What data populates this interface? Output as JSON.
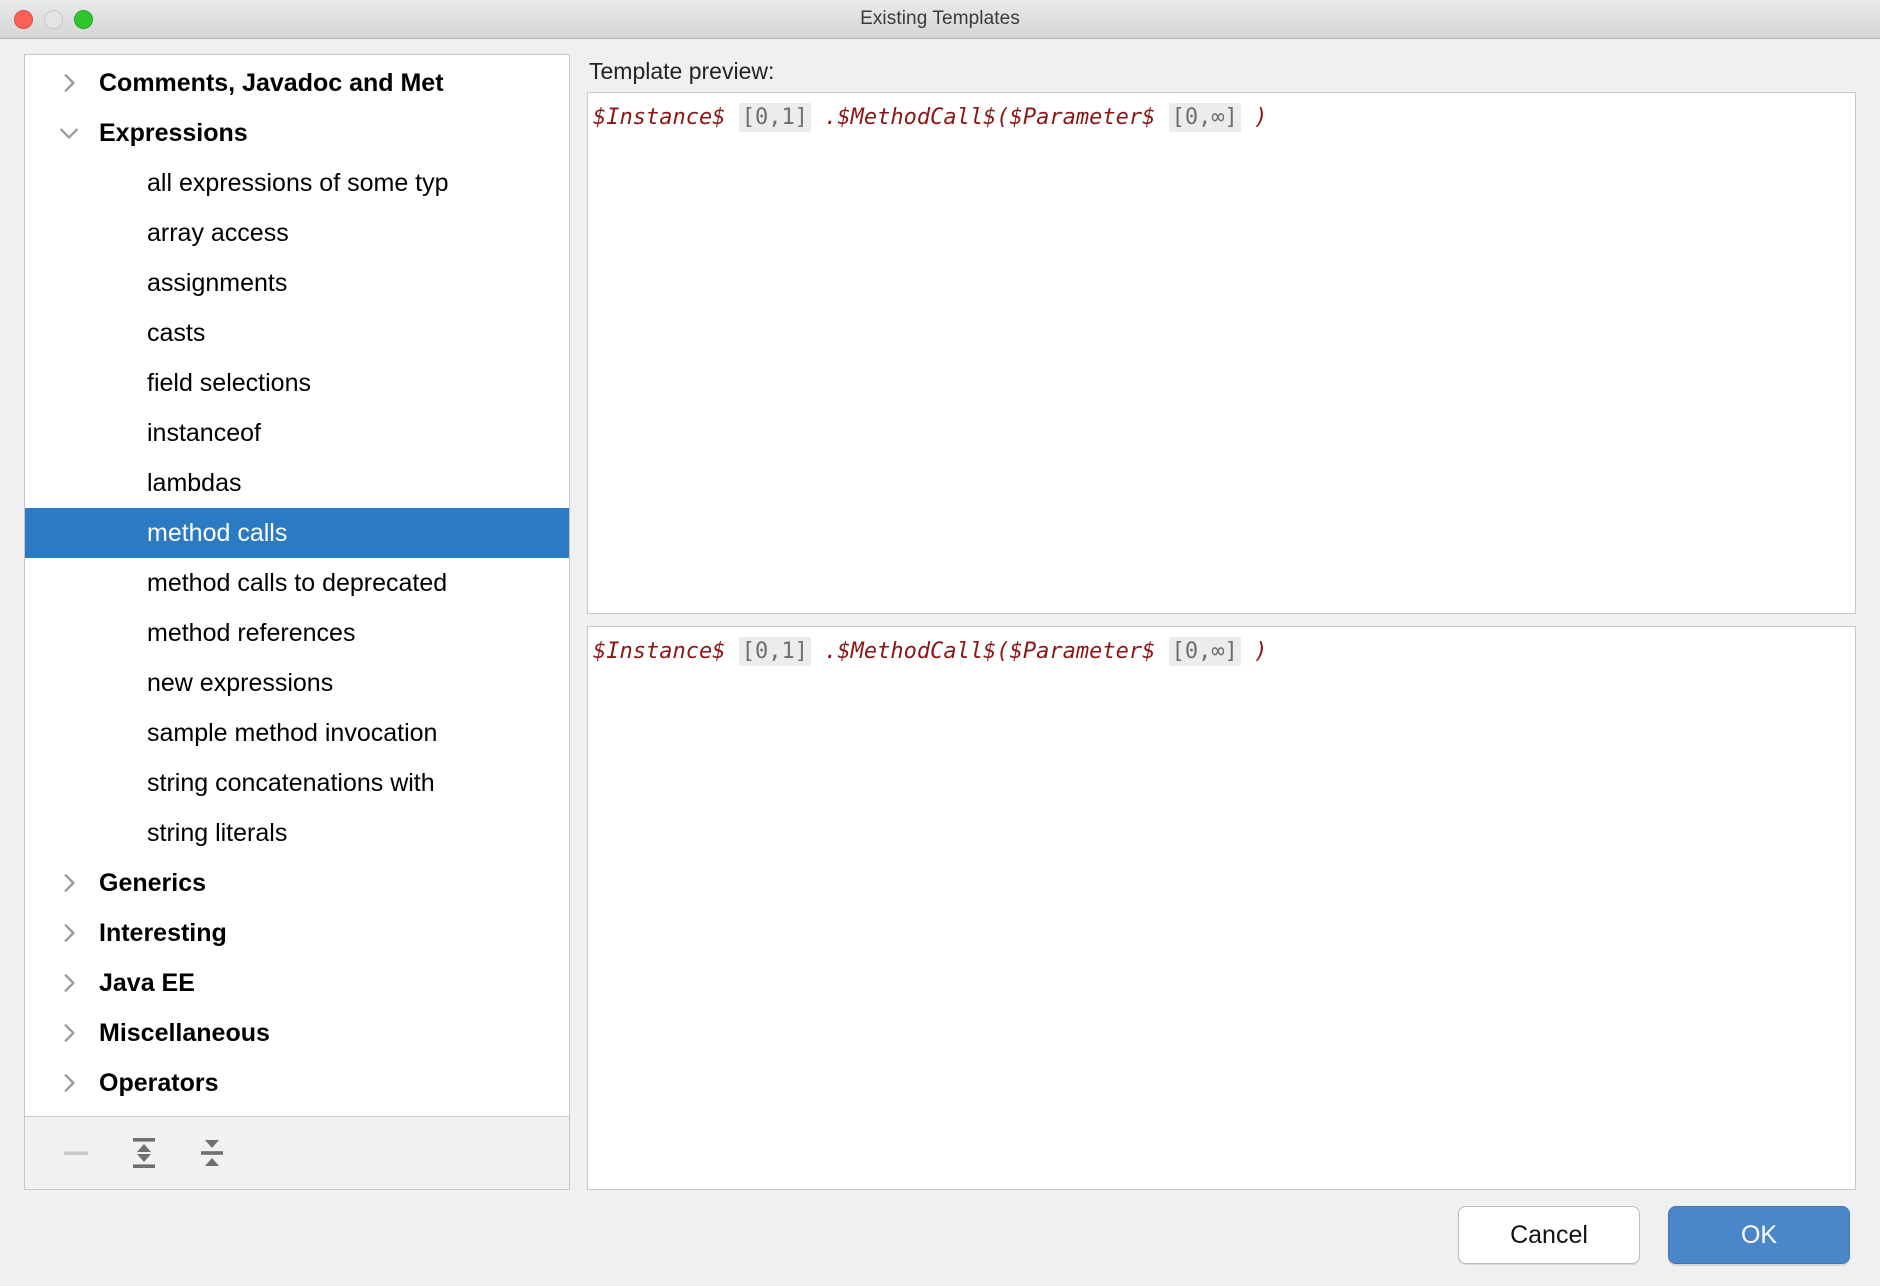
{
  "window": {
    "title": "Existing Templates",
    "traffic_lights": [
      "close-button",
      "minimize-button",
      "maximize-button"
    ]
  },
  "tree": {
    "items": [
      {
        "label": "Comments, Javadoc and Met",
        "type": "group",
        "expanded": false,
        "selected": false
      },
      {
        "label": "Expressions",
        "type": "group",
        "expanded": true,
        "selected": false
      },
      {
        "label": "all expressions of some typ",
        "type": "leaf",
        "selected": false
      },
      {
        "label": "array access",
        "type": "leaf",
        "selected": false
      },
      {
        "label": "assignments",
        "type": "leaf",
        "selected": false
      },
      {
        "label": "casts",
        "type": "leaf",
        "selected": false
      },
      {
        "label": "field selections",
        "type": "leaf",
        "selected": false
      },
      {
        "label": "instanceof",
        "type": "leaf",
        "selected": false
      },
      {
        "label": "lambdas",
        "type": "leaf",
        "selected": false
      },
      {
        "label": "method calls",
        "type": "leaf",
        "selected": true
      },
      {
        "label": "method calls to deprecated",
        "type": "leaf",
        "selected": false
      },
      {
        "label": "method references",
        "type": "leaf",
        "selected": false
      },
      {
        "label": "new expressions",
        "type": "leaf",
        "selected": false
      },
      {
        "label": "sample method invocation",
        "type": "leaf",
        "selected": false
      },
      {
        "label": "string concatenations with",
        "type": "leaf",
        "selected": false
      },
      {
        "label": "string literals",
        "type": "leaf",
        "selected": false
      },
      {
        "label": "Generics",
        "type": "group",
        "expanded": false,
        "selected": false
      },
      {
        "label": "Interesting",
        "type": "group",
        "expanded": false,
        "selected": false
      },
      {
        "label": "Java EE",
        "type": "group",
        "expanded": false,
        "selected": false
      },
      {
        "label": "Miscellaneous",
        "type": "group",
        "expanded": false,
        "selected": false
      },
      {
        "label": "Operators",
        "type": "group",
        "expanded": false,
        "selected": false
      }
    ],
    "toolbar": [
      {
        "icon": "remove-icon",
        "enabled": false
      },
      {
        "icon": "expand-all-icon",
        "enabled": true
      },
      {
        "icon": "collapse-all-icon",
        "enabled": true
      }
    ]
  },
  "preview": {
    "label": "Template preview:",
    "code_tokens": [
      {
        "text": "$Instance$",
        "kind": "var"
      },
      {
        "text": " ",
        "kind": "space"
      },
      {
        "text": "[0,1]",
        "kind": "count"
      },
      {
        "text": " ",
        "kind": "space"
      },
      {
        "text": ".$MethodCall$($Parameter$",
        "kind": "var"
      },
      {
        "text": " ",
        "kind": "space"
      },
      {
        "text": "[0,∞]",
        "kind": "count"
      },
      {
        "text": " ",
        "kind": "space"
      },
      {
        "text": ")",
        "kind": "punct"
      }
    ],
    "code_plain": "$Instance$ [0,1] .$MethodCall$($Parameter$ [0,∞] )"
  },
  "editor": {
    "code_tokens": [
      {
        "text": "$Instance$",
        "kind": "var"
      },
      {
        "text": " ",
        "kind": "space"
      },
      {
        "text": "[0,1]",
        "kind": "count"
      },
      {
        "text": " ",
        "kind": "space"
      },
      {
        "text": ".$MethodCall$($Parameter$",
        "kind": "var"
      },
      {
        "text": " ",
        "kind": "space"
      },
      {
        "text": "[0,∞]",
        "kind": "count"
      },
      {
        "text": " ",
        "kind": "space"
      },
      {
        "text": ")",
        "kind": "punct"
      }
    ],
    "code_plain": "$Instance$ [0,1] .$MethodCall$($Parameter$ [0,∞] )"
  },
  "footer": {
    "cancel_label": "Cancel",
    "ok_label": "OK"
  },
  "colors": {
    "selection_blue": "#2a7ac4",
    "ok_button_blue": "#4a86c8",
    "code_red": "#8c1616",
    "count_gray": "#6e6e6e"
  }
}
